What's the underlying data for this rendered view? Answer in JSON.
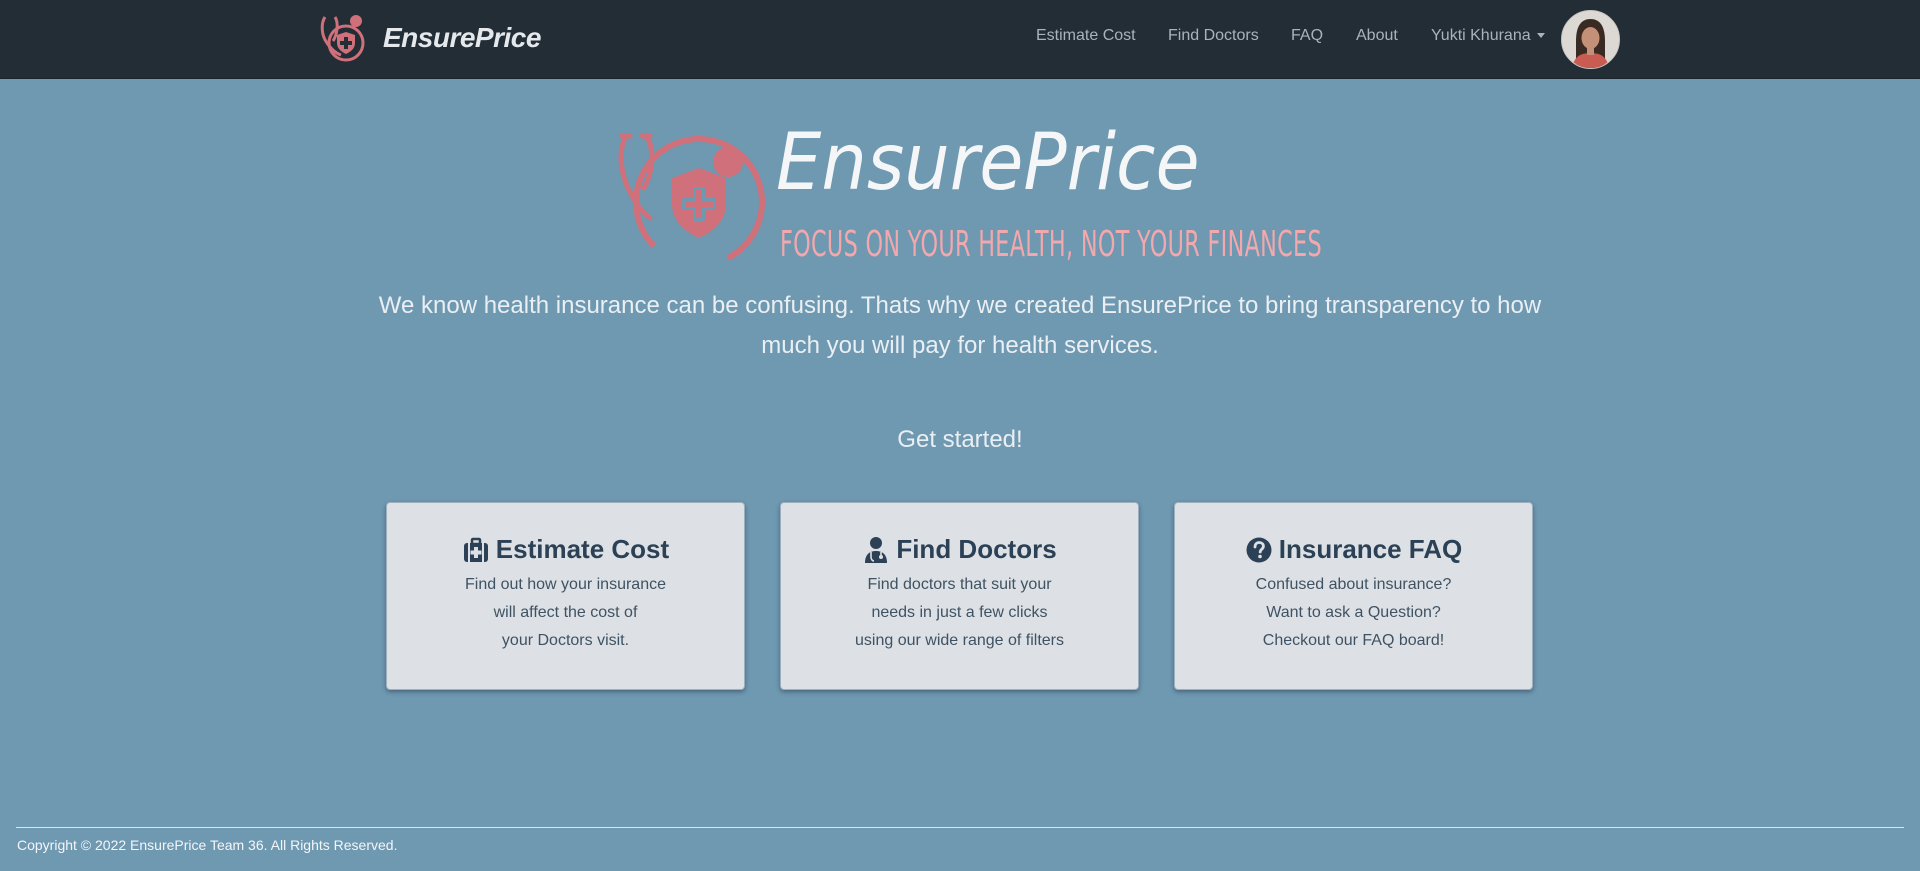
{
  "navbar": {
    "brand_name": "EnsurePrice",
    "links": [
      "Estimate Cost",
      "Find Doctors",
      "FAQ",
      "About"
    ],
    "user_name": "Yukti Khurana"
  },
  "hero": {
    "title": "EnsurePrice",
    "tagline": "FOCUS ON YOUR HEALTH, NOT YOUR FINANCES",
    "intro": "We know health insurance can be confusing. Thats why we created EnsurePrice to bring transparency to how much you will pay for health services.",
    "get_started": "Get started!"
  },
  "cards": [
    {
      "title": "Estimate Cost",
      "icon": "medkit-icon",
      "lines": [
        "Find out how your insurance",
        "will affect the cost of",
        "your Doctors visit."
      ]
    },
    {
      "title": "Find Doctors",
      "icon": "doctor-icon",
      "lines": [
        "Find doctors that suit your",
        "needs in just a few clicks",
        "using our wide range of filters"
      ]
    },
    {
      "title": "Insurance FAQ",
      "icon": "question-circle-icon",
      "lines": [
        "Confused about insurance?",
        "Want to ask a Question?",
        "Checkout our FAQ board!"
      ]
    }
  ],
  "footer": {
    "copyright": "Copyright © 2022 EnsurePrice Team 36. All Rights Reserved."
  },
  "colors": {
    "navbar_bg": "#222d36",
    "page_bg": "#6f98b1",
    "brand_accent": "#d0707a",
    "tagline": "#f2a8ad",
    "card_bg": "#dde1e5",
    "card_title": "#2c4156"
  }
}
